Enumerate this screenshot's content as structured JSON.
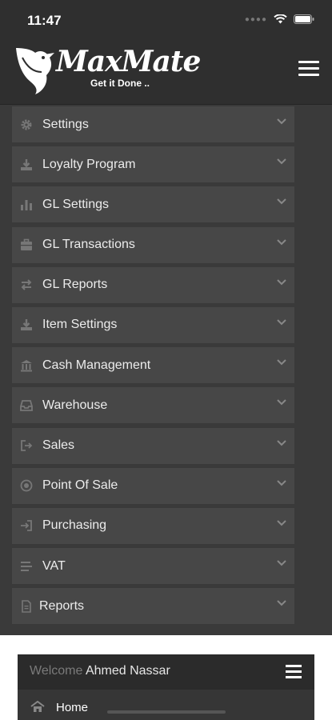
{
  "status": {
    "time": "11:47"
  },
  "app": {
    "name": "MaxMate",
    "tagline": "Get it Done .."
  },
  "menu": {
    "items": [
      {
        "label": "Settings",
        "icon": "gear-icon"
      },
      {
        "label": "Loyalty Program",
        "icon": "download-icon"
      },
      {
        "label": "GL Settings",
        "icon": "bar-chart-icon"
      },
      {
        "label": "GL Transactions",
        "icon": "briefcase-icon"
      },
      {
        "label": "GL Reports",
        "icon": "swap-arrows-icon"
      },
      {
        "label": "Item Settings",
        "icon": "download-icon"
      },
      {
        "label": "Cash Management",
        "icon": "bank-icon"
      },
      {
        "label": "Warehouse",
        "icon": "inbox-icon"
      },
      {
        "label": "Sales",
        "icon": "sign-out-icon"
      },
      {
        "label": "Point Of Sale",
        "icon": "dot-circle-icon"
      },
      {
        "label": "Purchasing",
        "icon": "sign-in-icon"
      },
      {
        "label": "VAT",
        "icon": "list-icon"
      },
      {
        "label": "Reports",
        "icon": "file-icon"
      }
    ]
  },
  "panel": {
    "welcome_prefix": "Welcome",
    "user_name": "Ahmed Nassar",
    "home_label": "Home"
  },
  "colors": {
    "background": "#3a3a3a",
    "item": "#474747",
    "header": "#2f2f2f"
  }
}
